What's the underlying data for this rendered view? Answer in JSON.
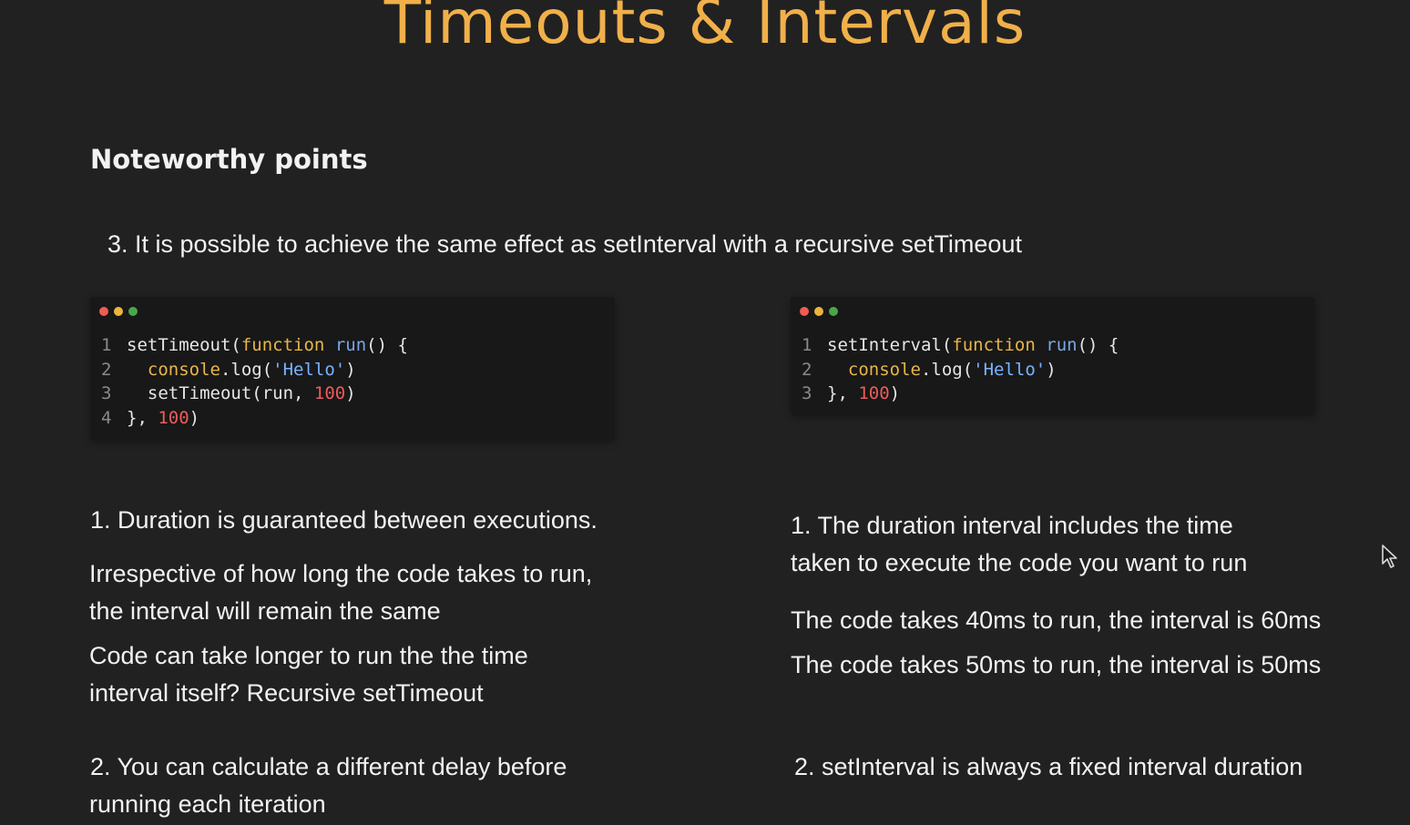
{
  "slide": {
    "title": "Timeouts & Intervals",
    "subtitle": "Noteworthy points",
    "point": "3. It is possible to achieve the same effect as setInterval with a recursive setTimeout"
  },
  "colors": {
    "background": "#212121",
    "title": "#f0b04a",
    "code_bg": "#181818",
    "dot_red": "#ee5c52",
    "dot_yellow": "#e9b53f",
    "dot_green": "#49a74a"
  },
  "code_left": {
    "lines": [
      {
        "num": "1",
        "tokens": [
          {
            "t": "setTimeout(",
            "k": "plain"
          },
          {
            "t": "function",
            "k": "kw"
          },
          {
            "t": " ",
            "k": "plain"
          },
          {
            "t": "run",
            "k": "fn"
          },
          {
            "t": "() {",
            "k": "plain"
          }
        ]
      },
      {
        "num": "2",
        "tokens": [
          {
            "t": "  ",
            "k": "plain"
          },
          {
            "t": "console",
            "k": "obj"
          },
          {
            "t": ".log(",
            "k": "plain"
          },
          {
            "t": "'Hello'",
            "k": "str"
          },
          {
            "t": ")",
            "k": "plain"
          }
        ]
      },
      {
        "num": "3",
        "tokens": [
          {
            "t": "  setTimeout(run, ",
            "k": "plain"
          },
          {
            "t": "100",
            "k": "num"
          },
          {
            "t": ")",
            "k": "plain"
          }
        ]
      },
      {
        "num": "4",
        "tokens": [
          {
            "t": "}, ",
            "k": "plain"
          },
          {
            "t": "100",
            "k": "num"
          },
          {
            "t": ")",
            "k": "plain"
          }
        ]
      }
    ]
  },
  "code_right": {
    "lines": [
      {
        "num": "1",
        "tokens": [
          {
            "t": "setInterval(",
            "k": "plain"
          },
          {
            "t": "function",
            "k": "kw"
          },
          {
            "t": " ",
            "k": "plain"
          },
          {
            "t": "run",
            "k": "fn"
          },
          {
            "t": "() {",
            "k": "plain"
          }
        ]
      },
      {
        "num": "2",
        "tokens": [
          {
            "t": "  ",
            "k": "plain"
          },
          {
            "t": "console",
            "k": "obj"
          },
          {
            "t": ".log(",
            "k": "plain"
          },
          {
            "t": "'Hello'",
            "k": "str"
          },
          {
            "t": ")",
            "k": "plain"
          }
        ]
      },
      {
        "num": "3",
        "tokens": [
          {
            "t": "}, ",
            "k": "plain"
          },
          {
            "t": "100",
            "k": "num"
          },
          {
            "t": ")",
            "k": "plain"
          }
        ]
      }
    ]
  },
  "left_notes": {
    "n1": "1. Duration is guaranteed between executions.",
    "n1_detail_line1": "Irrespective of how long the code takes to run,",
    "n1_detail_line2": "the interval will remain the same",
    "n1_question_line1": "Code can take longer to run the the time",
    "n1_question_line2": "interval itself? Recursive setTimeout",
    "n2_line1": "2. You can calculate a different delay before",
    "n2_line2": "running each iteration"
  },
  "right_notes": {
    "n1_line1": "1. The duration interval includes the time",
    "n1_line2": "taken to execute the code you want to run",
    "example1": "The code takes 40ms to run, the interval is 60ms",
    "example2": "The code takes 50ms to run, the interval is 50ms",
    "n2": "2. setInterval is always a fixed interval duration"
  },
  "cursor_icon": "mouse-pointer-icon"
}
